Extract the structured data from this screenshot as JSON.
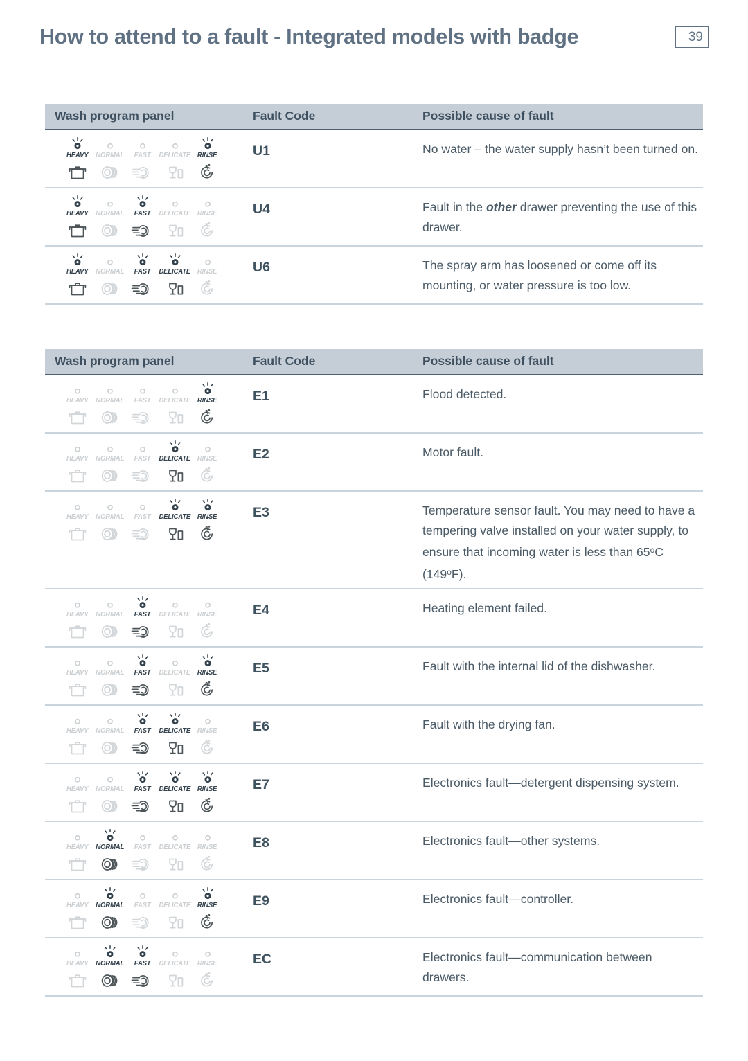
{
  "header": {
    "title": "How to attend to a fault - Integrated models with badge",
    "page_number": "39",
    "title_color": "#5f7183"
  },
  "programs": [
    "HEAVY",
    "NORMAL",
    "FAST",
    "DELICATE",
    "RINSE"
  ],
  "program_icons": [
    "pot-icon",
    "plates-icon",
    "rinse-plate-icon",
    "glassware-icon",
    "swirl-icon"
  ],
  "columns": {
    "panel": "Wash program panel",
    "code": "Fault Code",
    "cause": "Possible cause of fault"
  },
  "colors": {
    "header_bg": "#c5ced6",
    "header_rule": "#4c5f73",
    "row_rule": "#c9d4dd",
    "text": "#4a5a66",
    "led_on": "#33414c",
    "led_off": "#cbcfd2"
  },
  "tables": [
    {
      "id": "table-1",
      "rows": [
        {
          "leds": [
            true,
            false,
            false,
            false,
            true
          ],
          "code": "U1",
          "cause_html": "No water &ndash; the water supply hasn&rsquo;t been turned on.",
          "cause_text": "No water – the water supply hasn’t been turned on."
        },
        {
          "leds": [
            true,
            false,
            true,
            false,
            false
          ],
          "code": "U4",
          "cause_html": "Fault in the <b>other</b> drawer preventing the use of this drawer.",
          "cause_text": "Fault in the other drawer preventing the use of this drawer."
        },
        {
          "leds": [
            true,
            false,
            true,
            true,
            false
          ],
          "code": "U6",
          "cause_html": "The spray arm has loosened or come off its mounting, or water pressure is too low.",
          "cause_text": "The spray arm has loosened or come off its mounting, or water pressure is too low."
        }
      ]
    },
    {
      "id": "table-2",
      "rows": [
        {
          "leds": [
            false,
            false,
            false,
            false,
            true
          ],
          "code": "E1",
          "cause_html": "Flood detected.",
          "cause_text": "Flood detected."
        },
        {
          "leds": [
            false,
            false,
            false,
            true,
            false
          ],
          "code": "E2",
          "cause_html": "Motor fault.",
          "cause_text": "Motor fault."
        },
        {
          "leds": [
            false,
            false,
            false,
            true,
            true
          ],
          "code": "E3",
          "cause_html": "Temperature sensor fault. You may need to have a tempering valve installed on your water supply, to ensure that incoming water is less than 65<span class=\"sup\">o</span>C (149<span class=\"sup\">o</span>F).",
          "cause_text": "Temperature sensor fault. You may need to have a tempering valve installed on your water supply, to ensure that incoming water is less than 65oC (149oF)."
        },
        {
          "leds": [
            false,
            false,
            true,
            false,
            false
          ],
          "code": "E4",
          "cause_html": "Heating element failed.",
          "cause_text": "Heating element failed."
        },
        {
          "leds": [
            false,
            false,
            true,
            false,
            true
          ],
          "code": "E5",
          "cause_html": "Fault with the internal lid of the dishwasher.",
          "cause_text": "Fault with the internal lid of the dishwasher."
        },
        {
          "leds": [
            false,
            false,
            true,
            true,
            false
          ],
          "code": "E6",
          "cause_html": "Fault with the drying fan.",
          "cause_text": "Fault with the drying fan."
        },
        {
          "leds": [
            false,
            false,
            true,
            true,
            true
          ],
          "code": "E7",
          "cause_html": "Electronics fault&mdash;detergent dispensing system.",
          "cause_text": "Electronics fault—detergent dispensing system."
        },
        {
          "leds": [
            false,
            true,
            false,
            false,
            false
          ],
          "code": "E8",
          "cause_html": "Electronics fault&mdash;other systems.",
          "cause_text": "Electronics fault—other systems."
        },
        {
          "leds": [
            false,
            true,
            false,
            false,
            true
          ],
          "code": "E9",
          "cause_html": "Electronics fault&mdash;controller.",
          "cause_text": "Electronics fault—controller."
        },
        {
          "leds": [
            false,
            true,
            true,
            false,
            false
          ],
          "code": "EC",
          "cause_html": "Electronics fault&mdash;communication between drawers.",
          "cause_text": "Electronics fault—communication between drawers."
        }
      ]
    }
  ]
}
